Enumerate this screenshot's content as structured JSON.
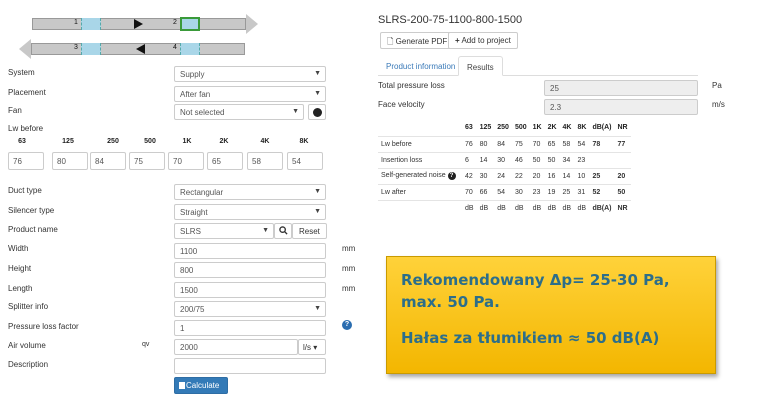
{
  "diagram": {
    "segments": [
      "1",
      "2",
      "3",
      "4"
    ]
  },
  "form": {
    "system": {
      "label": "System",
      "value": "Supply"
    },
    "placement": {
      "label": "Placement",
      "value": "After fan"
    },
    "fan": {
      "label": "Fan",
      "value": "Not selected"
    },
    "lw_before_label": "Lw before",
    "lw_bands": [
      "63",
      "125",
      "250",
      "500",
      "1K",
      "2K",
      "4K",
      "8K"
    ],
    "lw_values": [
      "76",
      "80",
      "84",
      "75",
      "70",
      "65",
      "58",
      "54"
    ],
    "duct_type": {
      "label": "Duct type",
      "value": "Rectangular"
    },
    "silencer_type": {
      "label": "Silencer type",
      "value": "Straight"
    },
    "product_name": {
      "label": "Product name",
      "value": "SLRS",
      "reset": "Reset"
    },
    "width": {
      "label": "Width",
      "value": "1100",
      "unit": "mm"
    },
    "height": {
      "label": "Height",
      "value": "800",
      "unit": "mm"
    },
    "length": {
      "label": "Length",
      "value": "1500",
      "unit": "mm"
    },
    "splitter_info": {
      "label": "Splitter info",
      "value": "200/75"
    },
    "pressure_loss_factor": {
      "label": "Pressure loss factor",
      "value": "1"
    },
    "air_volume": {
      "label": "Air volume",
      "symbol": "qv",
      "value": "2000",
      "unit": "l/s"
    },
    "description": {
      "label": "Description",
      "value": ""
    },
    "calculate": "Calculate"
  },
  "results": {
    "title": "SLRS-200-75-1100-800-1500",
    "generate_pdf": "Generate PDF",
    "add_to_project": "Add to project",
    "tabs": [
      "Product information",
      "Results"
    ],
    "total_pressure_loss": {
      "label": "Total pressure loss",
      "value": "25",
      "unit": "Pa"
    },
    "face_velocity": {
      "label": "Face velocity",
      "value": "2.3",
      "unit": "m/s"
    },
    "table": {
      "headers": [
        "",
        "63",
        "125",
        "250",
        "500",
        "1K",
        "2K",
        "4K",
        "8K",
        "dB(A)",
        "NR"
      ],
      "rows": [
        [
          "Lw before",
          "76",
          "80",
          "84",
          "75",
          "70",
          "65",
          "58",
          "54",
          "78",
          "77"
        ],
        [
          "Insertion loss",
          "6",
          "14",
          "30",
          "46",
          "50",
          "50",
          "34",
          "23",
          "",
          ""
        ],
        [
          "Self-generated noise",
          "42",
          "30",
          "24",
          "22",
          "20",
          "16",
          "14",
          "10",
          "25",
          "20"
        ],
        [
          "Lw after",
          "70",
          "66",
          "54",
          "30",
          "23",
          "19",
          "25",
          "31",
          "52",
          "50"
        ],
        [
          "",
          "dB",
          "dB",
          "dB",
          "dB",
          "dB",
          "dB",
          "dB",
          "dB",
          "dB(A)",
          "NR"
        ]
      ]
    }
  },
  "note": {
    "line1": "Rekomendowany Δp= 25-30 Pa,",
    "line2": "max. 50 Pa.",
    "line3": "Hałas za tłumikiem ≈ 50 dB(A)"
  }
}
